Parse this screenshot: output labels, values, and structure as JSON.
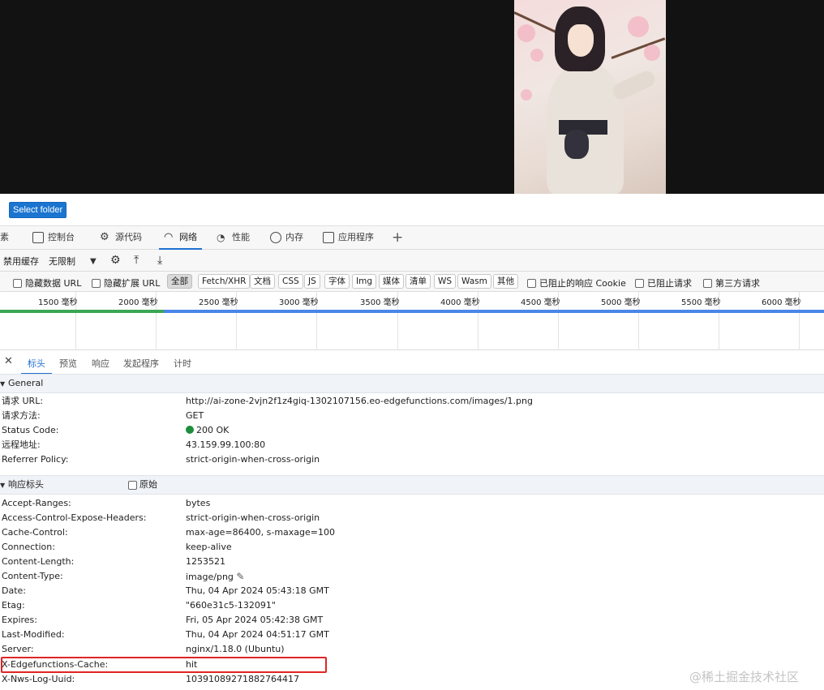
{
  "viewer": {
    "select_folder_label": "Select folder"
  },
  "devtools": {
    "tabs": [
      {
        "label": "素",
        "icon": "elements-icon"
      },
      {
        "label": "控制台",
        "icon": "console-icon"
      },
      {
        "label": "源代码",
        "icon": "sources-icon"
      },
      {
        "label": "网络",
        "icon": "wifi-icon"
      },
      {
        "label": "性能",
        "icon": "performance-icon"
      },
      {
        "label": "内存",
        "icon": "memory-icon"
      },
      {
        "label": "应用程序",
        "icon": "application-icon"
      }
    ],
    "add_tab": "+",
    "toolbar": {
      "disable_cache": "禁用缓存",
      "throttle": "无限制"
    },
    "filters": {
      "hide_data_url": "隐藏数据 URL",
      "hide_ext_url": "隐藏扩展 URL",
      "types": [
        "全部",
        "Fetch/XHR",
        "文档",
        "CSS",
        "JS",
        "字体",
        "Img",
        "媒体",
        "清单",
        "WS",
        "Wasm",
        "其他"
      ],
      "active_type": "全部",
      "blocked_cookies": "已阻止的响应 Cookie",
      "blocked_requests": "已阻止请求",
      "third_party": "第三方请求"
    },
    "timeline": {
      "ticks": [
        "1500 毫秒",
        "2000 毫秒",
        "2500 毫秒",
        "3000 毫秒",
        "3500 毫秒",
        "4000 毫秒",
        "4500 毫秒",
        "5000 毫秒",
        "5500 毫秒",
        "6000 毫秒"
      ]
    },
    "detail_tabs": {
      "close": "✕",
      "items": [
        "标头",
        "预览",
        "响应",
        "发起程序",
        "计时"
      ],
      "active": "标头"
    },
    "general": {
      "title": "General",
      "rows": [
        {
          "k": "请求 URL:",
          "v": "http://ai-zone-2vjn2f1z4giq-1302107156.eo-edgefunctions.com/images/1.png"
        },
        {
          "k": "请求方法:",
          "v": "GET"
        },
        {
          "k": "Status Code:",
          "v": "200 OK"
        },
        {
          "k": "远程地址:",
          "v": "43.159.99.100:80"
        },
        {
          "k": "Referrer Policy:",
          "v": "strict-origin-when-cross-origin"
        }
      ]
    },
    "response_headers": {
      "title": "响应标头",
      "raw_label": "原始",
      "rows": [
        {
          "k": "Accept-Ranges:",
          "v": "bytes"
        },
        {
          "k": "Access-Control-Expose-Headers:",
          "v": "strict-origin-when-cross-origin"
        },
        {
          "k": "Cache-Control:",
          "v": "max-age=86400, s-maxage=100"
        },
        {
          "k": "Connection:",
          "v": "keep-alive"
        },
        {
          "k": "Content-Length:",
          "v": "1253521"
        },
        {
          "k": "Content-Type:",
          "v": "image/png"
        },
        {
          "k": "Date:",
          "v": "Thu, 04 Apr 2024 05:43:18 GMT"
        },
        {
          "k": "Etag:",
          "v": "\"660e31c5-132091\""
        },
        {
          "k": "Expires:",
          "v": "Fri, 05 Apr 2024 05:42:38 GMT"
        },
        {
          "k": "Last-Modified:",
          "v": "Thu, 04 Apr 2024 04:51:17 GMT"
        },
        {
          "k": "Server:",
          "v": "nginx/1.18.0 (Ubuntu)"
        },
        {
          "k": "X-Edgefunctions-Cache:",
          "v": "hit"
        },
        {
          "k": "X-Nws-Log-Uuid:",
          "v": "10391089271882764417"
        }
      ]
    }
  },
  "watermark": "@稀土掘金技术社区",
  "colors": {
    "accent": "#1f6fd1",
    "status_ok": "#1e8e3e",
    "highlight": "#e02424"
  }
}
